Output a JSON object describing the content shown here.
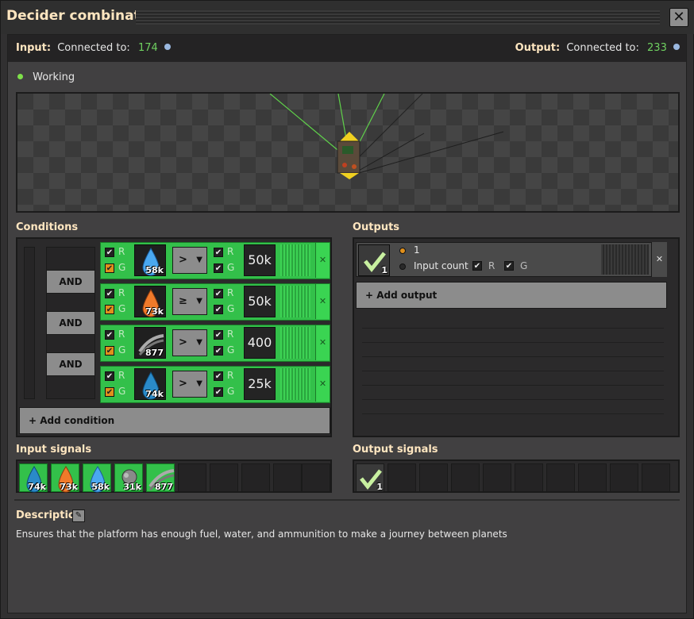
{
  "window": {
    "title": "Decider combinator",
    "close_glyph": "✕"
  },
  "connections": {
    "input_label": "Input:",
    "input_text": "Connected to:",
    "input_value": "174",
    "output_label": "Output:",
    "output_text": "Connected to:",
    "output_value": "233"
  },
  "status": {
    "text": "Working",
    "color": "#7ee04a"
  },
  "conditions": {
    "title": "Conditions",
    "and_label": "AND",
    "add_label": "+ Add condition",
    "rows": [
      {
        "left_count": "58k",
        "left_icon": "water-drop-icon",
        "op": ">",
        "right_value": "50k"
      },
      {
        "left_count": "73k",
        "left_icon": "fuel-drop-icon",
        "op": "≥",
        "right_value": "50k"
      },
      {
        "left_count": "877",
        "left_icon": "rail-icon",
        "op": ">",
        "right_value": "400"
      },
      {
        "left_count": "74k",
        "left_icon": "oxidizer-drop-icon",
        "op": ">",
        "right_value": "25k"
      }
    ],
    "r_label": "R",
    "g_label": "G"
  },
  "outputs": {
    "title": "Outputs",
    "signal_count": "1",
    "option_constant": "1",
    "option_input_count": "Input count",
    "r_label": "R",
    "g_label": "G",
    "add_label": "+ Add output"
  },
  "input_signals": {
    "title": "Input signals",
    "items": [
      {
        "icon": "oxidizer-drop-icon",
        "count": "74k"
      },
      {
        "icon": "fuel-drop-icon",
        "count": "73k"
      },
      {
        "icon": "water-drop-icon",
        "count": "58k"
      },
      {
        "icon": "ammo-icon",
        "count": "31k"
      },
      {
        "icon": "rail-icon",
        "count": "877"
      }
    ]
  },
  "output_signals": {
    "title": "Output signals",
    "items": [
      {
        "icon": "check-icon",
        "count": "1"
      }
    ]
  },
  "description": {
    "title": "Description",
    "text": "Ensures that the platform has enough fuel, water, and ammunition to make a journey between planets"
  },
  "colors": {
    "accent_green": "#33c04a",
    "heading": "#ffe6c0",
    "connected_value": "#6fd060"
  }
}
